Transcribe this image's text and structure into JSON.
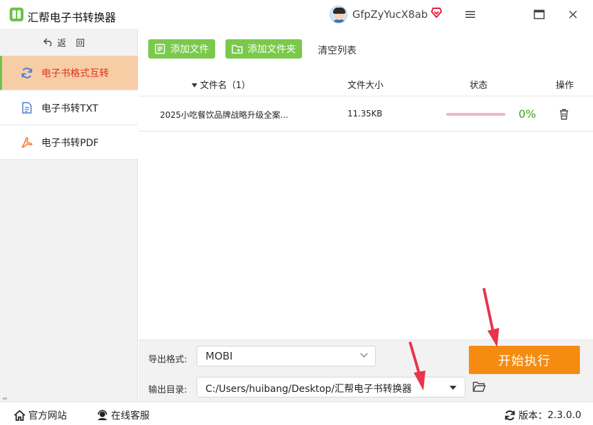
{
  "app": {
    "title": "汇帮电子书转换器",
    "username": "GfpZyYucX8ab",
    "accent_color": "#6cc24a",
    "icons": [
      "app-logo-icon",
      "avatar",
      "vip-heart-icon",
      "menu-icon",
      "maximize-icon",
      "close-icon"
    ]
  },
  "sidebar": {
    "back_label": "返回",
    "items": [
      {
        "label": "电子书格式互转",
        "icon": "refresh-icon",
        "active": true
      },
      {
        "label": "电子书转TXT",
        "icon": "document-icon",
        "active": false
      },
      {
        "label": "电子书转PDF",
        "icon": "pdf-icon",
        "active": false
      }
    ],
    "active_bg_color": "#f7cda6",
    "active_text_color": "#e0321a"
  },
  "toolbar": {
    "add_file_label": "添加文件",
    "add_folder_label": "添加文件夹",
    "clear_label": "清空列表",
    "button_color": "#7ac94b"
  },
  "table": {
    "headers": {
      "name": "文件名（1）",
      "size": "文件大小",
      "status": "状态",
      "ops": "操作"
    },
    "rows": [
      {
        "name": "2025小吃餐饮品牌战略升级全案...",
        "size": "11.35KB",
        "progress": 0,
        "percent": "0%"
      }
    ]
  },
  "settings": {
    "format_label": "导出格式:",
    "format_value": "MOBI",
    "dir_label": "输出目录:",
    "dir_value": "C:/Users/huibang/Desktop/汇帮电子书转换器",
    "start_label": "开始执行",
    "start_color": "#f58b10",
    "arrow_color": "#e8344e"
  },
  "statusbar": {
    "website_label": "官方网站",
    "service_label": "在线客服",
    "version_label": "版本：",
    "version_value": "2.3.0.0"
  }
}
